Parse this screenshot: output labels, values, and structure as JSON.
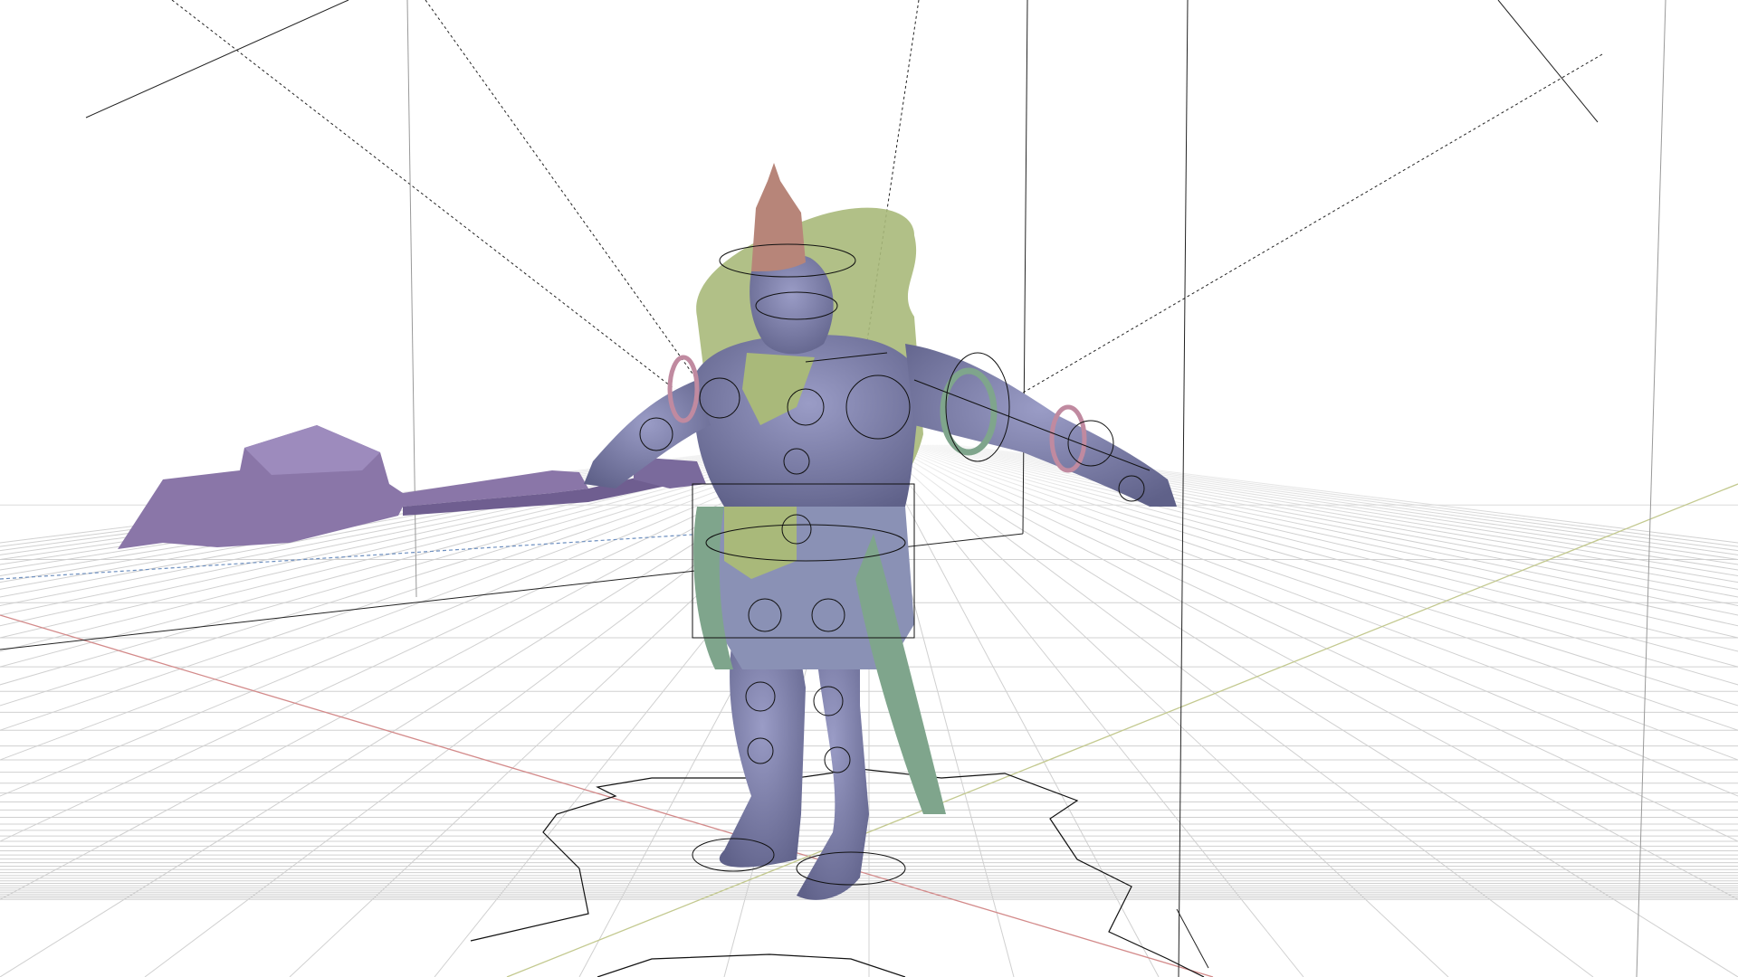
{
  "app": {
    "name": "",
    "view": "3D viewport"
  },
  "viewport": {
    "background": "#ffffff",
    "grid_color": "#d0d0d0",
    "x_axis_color": "#d38a8a",
    "y_axis_color": "#c3c98f",
    "z_axis_color": "#6d8fbf"
  },
  "scene": {
    "object_type": "rigged character",
    "body_color": "#7c7ea6",
    "crown_color": "#b78579",
    "cloak_color": "#a9b97a",
    "sash_color": "#7fa58c",
    "weapon_color": "#8a76a8",
    "controls_color": "#111111"
  }
}
